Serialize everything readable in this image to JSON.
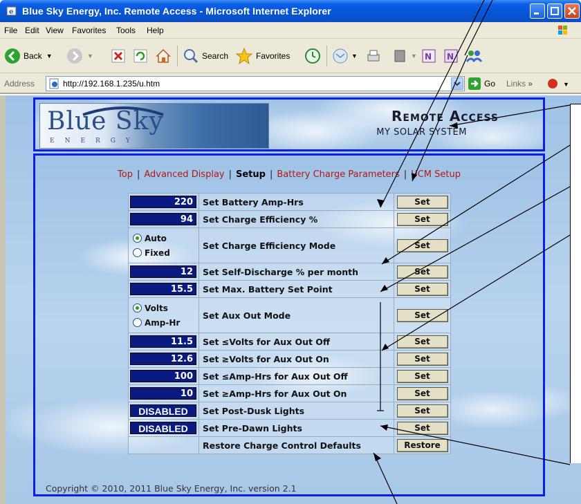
{
  "window": {
    "title": "Blue Sky Energy, Inc. Remote Access - Microsoft Internet Explorer"
  },
  "menu": [
    "File",
    "Edit",
    "View",
    "Favorites",
    "Tools",
    "Help"
  ],
  "toolbar": {
    "back": "Back",
    "search": "Search",
    "favorites": "Favorites"
  },
  "address": {
    "label": "Address",
    "url": "http://192.168.1.235/u.htm",
    "go": "Go",
    "links": "Links"
  },
  "header": {
    "logo": "Blue Sky",
    "logo_sub": "ENERGY",
    "title": "Remote Access",
    "subtitle": "MY SOLAR SYSTEM"
  },
  "nav": {
    "top": "Top",
    "advanced": "Advanced Display",
    "setup": "Setup",
    "battery": "Battery Charge Parameters",
    "ucm": "UCM Setup",
    "sep": "|"
  },
  "rows": [
    {
      "value": "220",
      "label": "Set Battery Amp-Hrs",
      "button": "Set"
    },
    {
      "value": "94",
      "label": "Set Charge Efficiency %",
      "button": "Set"
    },
    {
      "options": [
        "Auto",
        "Fixed"
      ],
      "selected": "Auto",
      "label": "Set Charge Efficiency Mode",
      "button": "Set"
    },
    {
      "value": "12",
      "label": "Set Self-Discharge % per month",
      "button": "Set"
    },
    {
      "value": "15.5",
      "label": "Set Max. Battery Set Point",
      "button": "Set"
    },
    {
      "options": [
        "Volts",
        "Amp-Hr"
      ],
      "selected": "Volts",
      "label": "Set Aux Out Mode",
      "button": "Set"
    },
    {
      "value": "11.5",
      "label": "Set ≤Volts for Aux Out Off",
      "button": "Set"
    },
    {
      "value": "12.6",
      "label": "Set ≥Volts for Aux Out On",
      "button": "Set"
    },
    {
      "value": "100",
      "label": "Set ≤Amp-Hrs for Aux Out Off",
      "button": "Set"
    },
    {
      "value": "10",
      "label": "Set ≥Amp-Hrs for Aux Out On",
      "button": "Set"
    },
    {
      "value": "DISABLED",
      "label": "Set Post-Dusk Lights",
      "button": "Set"
    },
    {
      "value": "DISABLED",
      "label": "Set Pre-Dawn Lights",
      "button": "Set"
    },
    {
      "value": "",
      "label": "Restore Charge Control Defaults",
      "button": "Restore"
    }
  ],
  "footer": {
    "copyright": "Copyright © 2010, 2011 Blue Sky Energy, Inc. version 2.1"
  },
  "colors": {
    "title_blue": "#0754d4",
    "frame_blue": "#0a1ee6",
    "value_bg": "#0b1a80",
    "link_red": "#b01818"
  }
}
